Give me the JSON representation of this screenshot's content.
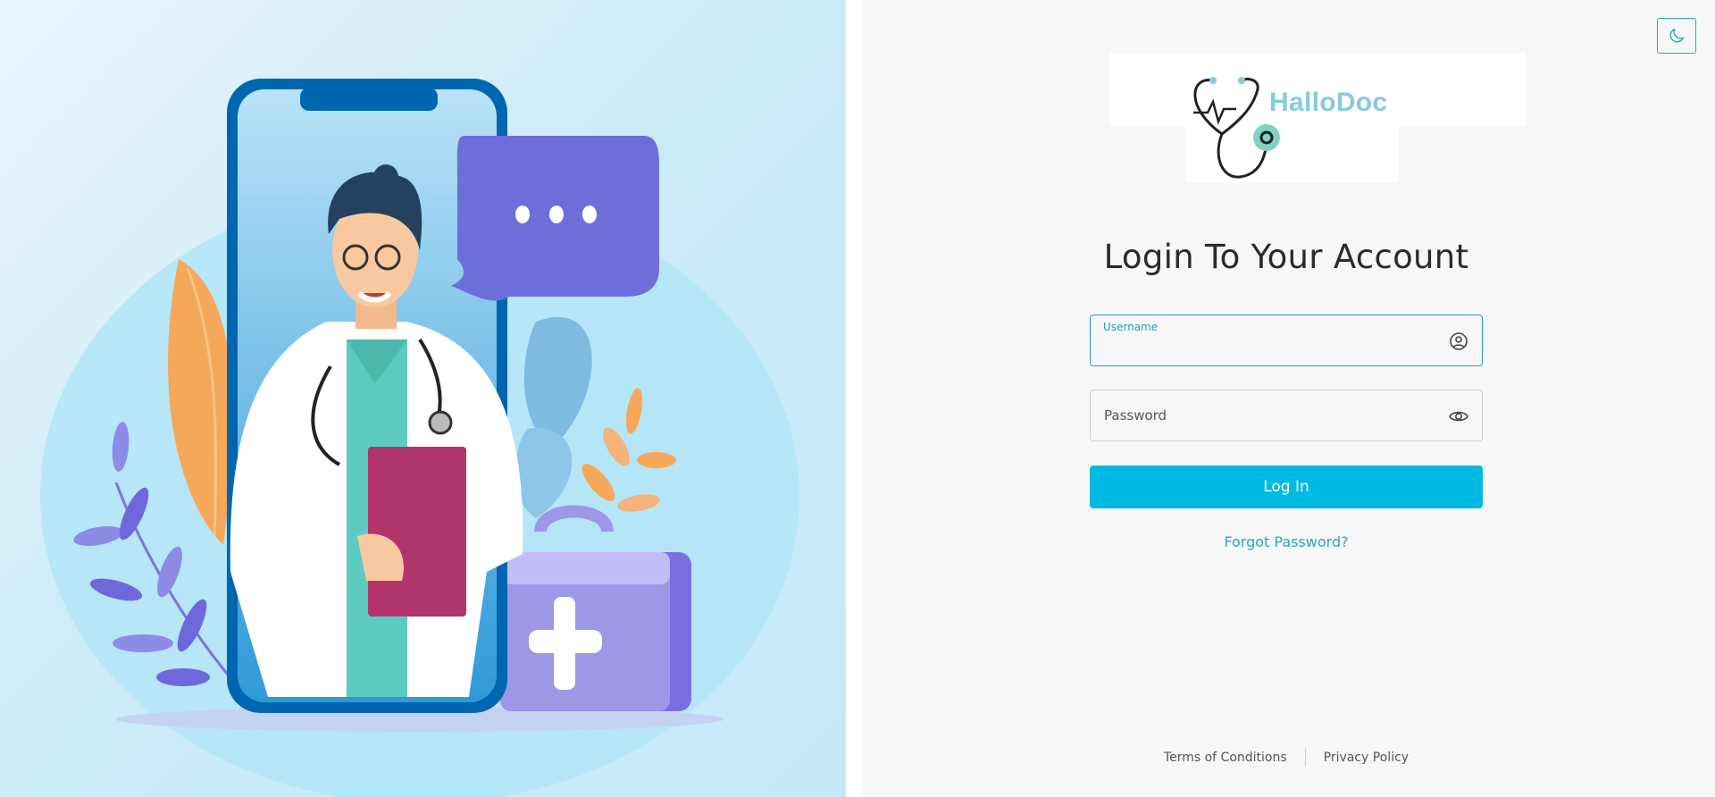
{
  "brand": {
    "name": "HalloDoc"
  },
  "header": {
    "title": "Login To Your Account"
  },
  "theme_toggle": {
    "icon": "moon-icon"
  },
  "form": {
    "username": {
      "label": "Username",
      "value": "",
      "icon": "user-circle-icon"
    },
    "password": {
      "placeholder": "Password",
      "value": "",
      "icon": "eye-icon"
    },
    "submit_label": "Log In",
    "forgot_label": "Forgot Password?"
  },
  "footer": {
    "terms": "Terms of Conditions",
    "privacy": "Privacy Policy"
  },
  "colors": {
    "accent": "#00bae3",
    "link": "#2aa6bf",
    "field_border": "#26a0b5",
    "illustration_bg": "#c6e9fa"
  }
}
